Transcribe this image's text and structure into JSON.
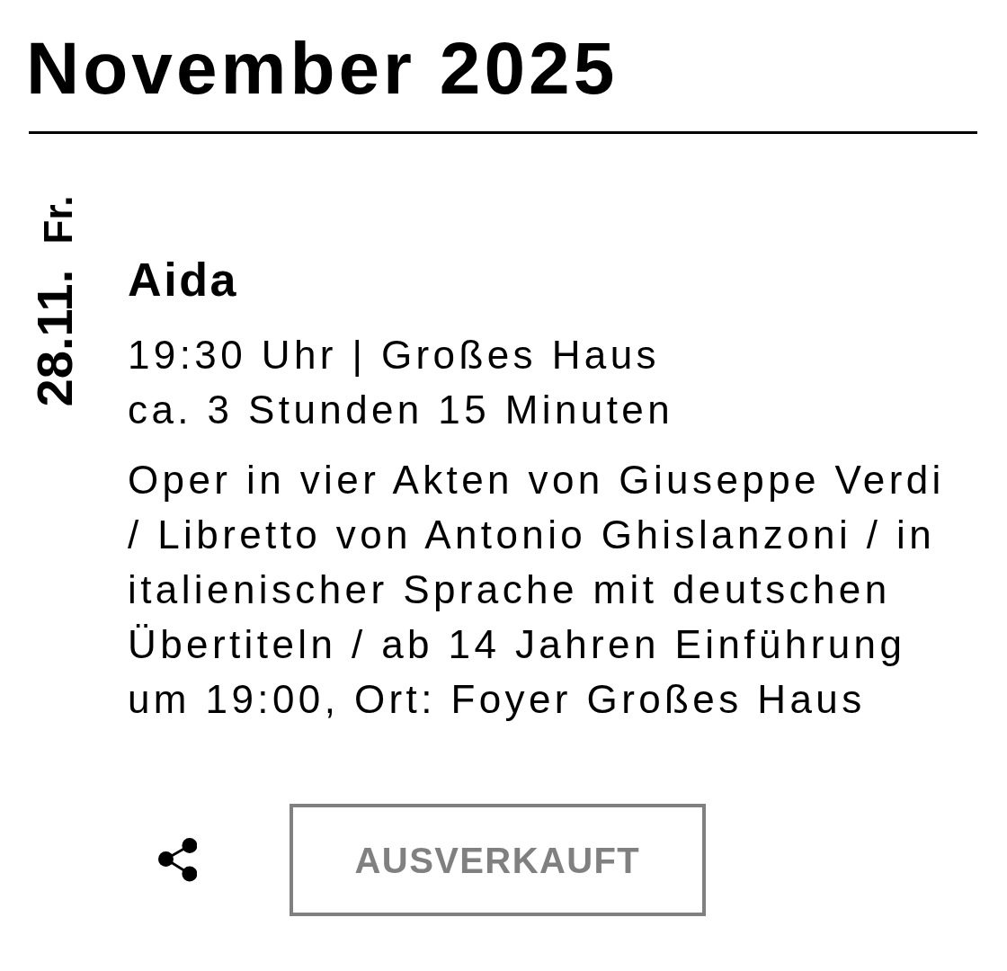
{
  "month_heading": "November 2025",
  "events": [
    {
      "date": "28.11.",
      "weekday": "Fr.",
      "title": "Aida",
      "time_venue": "19:30 Uhr | Großes Haus",
      "duration": "ca. 3 Stunden 15 Minuten",
      "description": "Oper in vier Akten von Giuseppe Verdi / Libretto von Antonio Ghislanzoni / in italienischer Sprache mit deutschen Übertiteln / ab 14 Jahren Einführung um 19:00, Ort: Foyer Großes Haus",
      "ticket_button": {
        "label": "AUSVERKAUFT",
        "disabled": true
      }
    }
  ]
}
